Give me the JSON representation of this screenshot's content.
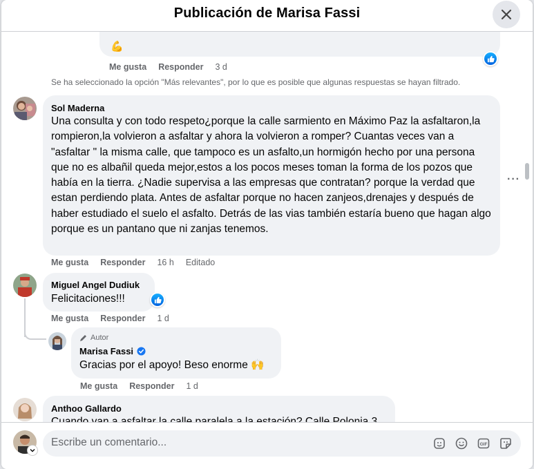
{
  "window": {
    "title": "Publicación de Marisa Fassi"
  },
  "top_comment": {
    "emoji": "💪",
    "actions": {
      "like": "Me gusta",
      "reply": "Responder",
      "time": "3 d"
    }
  },
  "filter_notice": "Se ha seleccionado la opción \"Más relevantes\", por lo que es posible que algunas respuestas se hayan filtrado.",
  "comments": [
    {
      "author": "Sol Maderna",
      "text": "Una consulta y con todo respeto¿porque la calle sarmiento en Máximo Paz la asfaltaron,la rompieron,la volvieron a asfaltar y ahora la volvieron a romper? Cuantas veces van a \"asfaltar \" la misma calle, que tampoco es un asfalto,un hormigón hecho por una persona que no es albañil queda mejor,estos a los pocos meses toman la forma de los pozos que había en la tierra. ¿Nadie supervisa a las empresas que contratan? porque la verdad que estan perdiendo plata. Antes de asfaltar porque no hacen zanjeos,drenajes y después de haber estudiado el suelo el asfalto. Detrás de las vias también estaría bueno que hagan algo porque es un pantano que ni zanjas tenemos.",
      "like": "Me gusta",
      "reply": "Responder",
      "time": "16 h",
      "edited": "Editado"
    },
    {
      "author": "Miguel Angel Dudiuk",
      "text": "Felicitaciones!!!",
      "like": "Me gusta",
      "reply": "Responder",
      "time": "1 d"
    },
    {
      "author": "Anthoo Gallardo",
      "text": "Cuando van a asfaltar la calle paralela a la estación? Calle Polonia 3"
    }
  ],
  "reply": {
    "badge": "Autor",
    "author": "Marisa Fassi",
    "text": "Gracias por el apoyo! Beso enorme 🙌",
    "like": "Me gusta",
    "reply": "Responder",
    "time": "1 d"
  },
  "composer": {
    "placeholder": "Escribe un comentario..."
  },
  "icons": [
    "close-icon",
    "like-icon",
    "edit-pencil-icon",
    "verified-icon",
    "avatar-sticker-icon",
    "emoji-icon",
    "gif-icon",
    "sticker-icon",
    "more-icon"
  ],
  "colors": {
    "accent": "#1877f2",
    "bubble": "#f0f2f5",
    "secondary_text": "#65676b"
  }
}
